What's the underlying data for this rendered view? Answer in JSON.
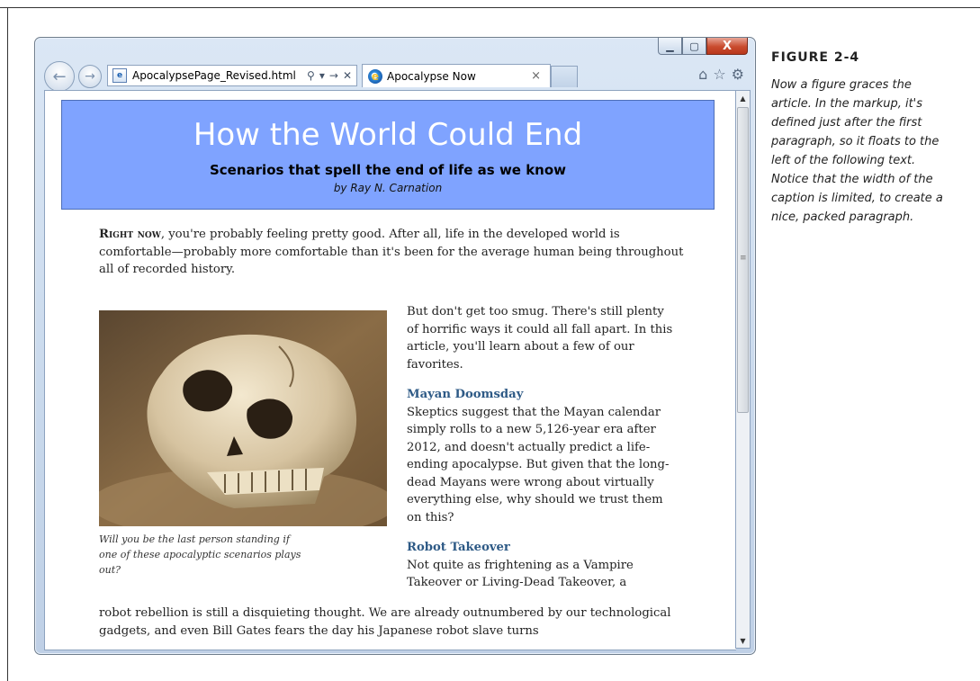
{
  "browser": {
    "address_url": "ApocalypsePage_Revised.html",
    "tab_title": "Apocalypse Now",
    "controls": {
      "minimize": "▁",
      "maximize": "▢",
      "close": "X"
    },
    "icons": [
      "back-icon",
      "forward-icon",
      "search-icon",
      "refresh-icon",
      "stop-icon",
      "home-icon",
      "favorites-icon",
      "tools-icon"
    ]
  },
  "header": {
    "title": "How the World Could End",
    "subtitle": "Scenarios that spell the end of life as we know",
    "byline": "by Ray N. Carnation"
  },
  "article": {
    "lead_caps": "Right now",
    "lead_rest": ", you're probably feeling pretty good. After all, life in the developed world is comfortable—probably more comfortable than it's been for the average human being throughout all of recorded history.",
    "para2": "But don't get too smug. There's still plenty of horrific ways it could all fall apart. In this article, you'll learn about a few of our favorites.",
    "heading1": "Mayan Doomsday",
    "para3": "Skeptics suggest that the Mayan calendar simply rolls to a new 5,126-year era after 2012, and doesn't actually predict a life-ending apocalypse. But given that the long-dead Mayans were wrong about virtually everything else, why should we trust them on this?",
    "heading2": "Robot Takeover",
    "para4_start": "Not quite as frightening as a Vampire Takeover or Living-Dead Takeover, a",
    "para4_rest": "robot rebellion is still a disquieting thought. We are already outnumbered by our technological gadgets, and even Bill Gates fears the day his Japanese robot slave turns",
    "figure_caption": "Will you be the last person standing if one of these apocalyptic scenarios plays out?"
  },
  "book_caption": {
    "label": "FIGURE 2-4",
    "text": "Now a figure graces the article. In the markup, it's defined just after the first paragraph, so it floats to the left of the following text. Notice that the width of the caption is limited, to create a nice, packed paragraph."
  },
  "colors": {
    "header_bg": "#7fa3ff",
    "heading": "#2e5a86",
    "close_button": "#c94b2e"
  }
}
